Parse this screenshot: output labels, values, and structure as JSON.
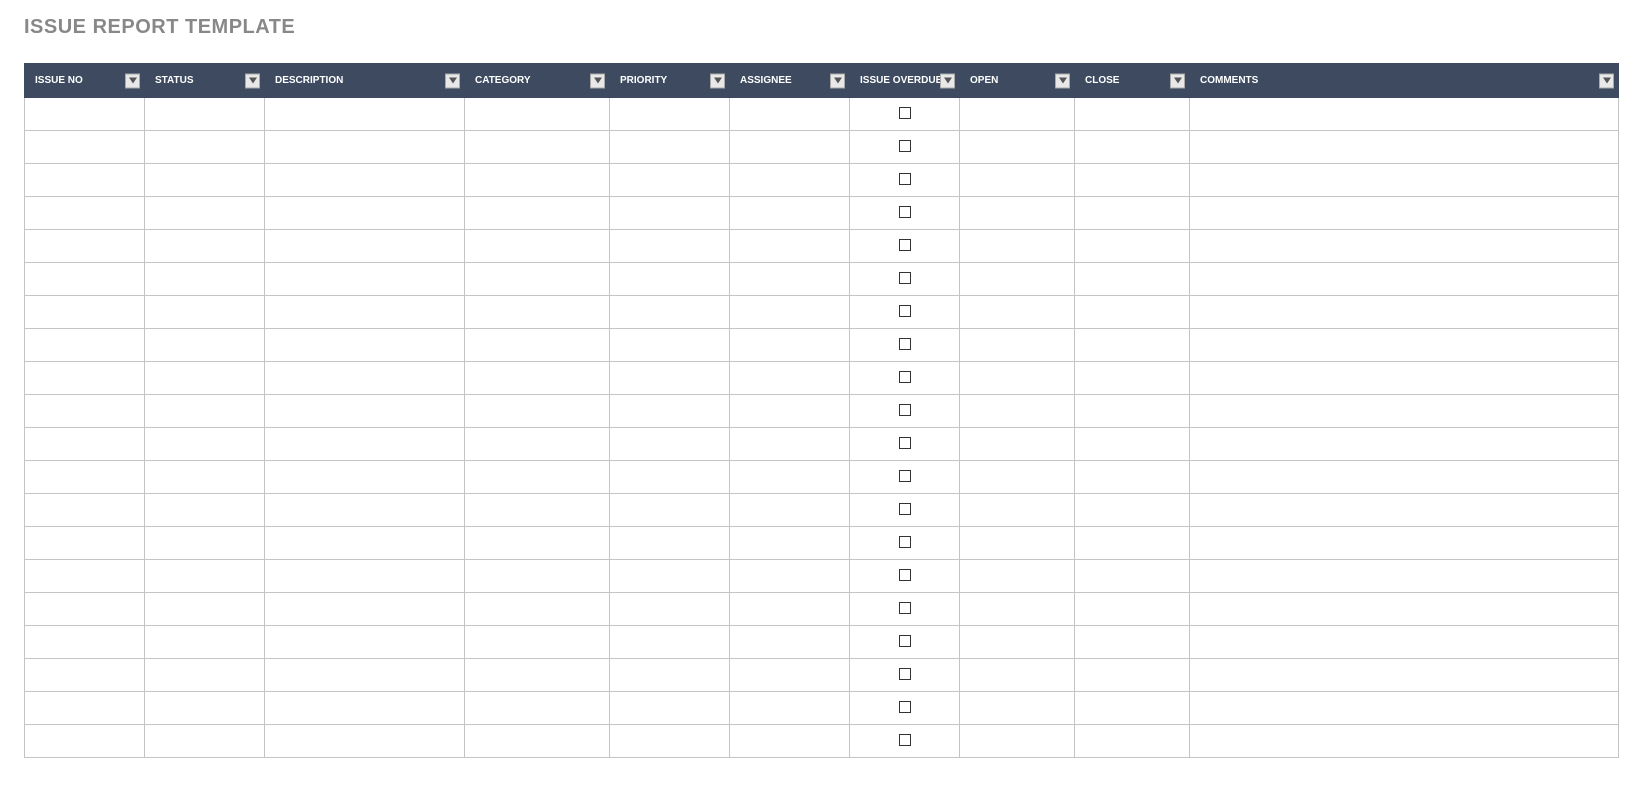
{
  "title": "ISSUE REPORT TEMPLATE",
  "columns": [
    {
      "key": "issue_no",
      "label": "ISSUE NO",
      "class": "col-issue-no",
      "filter": true
    },
    {
      "key": "status",
      "label": "STATUS",
      "class": "col-status",
      "filter": true
    },
    {
      "key": "description",
      "label": "DESCRIPTION",
      "class": "col-description",
      "filter": true
    },
    {
      "key": "category",
      "label": "CATEGORY",
      "class": "col-category",
      "filter": true
    },
    {
      "key": "priority",
      "label": "PRIORITY",
      "class": "col-priority",
      "filter": true
    },
    {
      "key": "assignee",
      "label": "ASSIGNEE",
      "class": "col-assignee",
      "filter": true
    },
    {
      "key": "overdue",
      "label": "ISSUE OVERDUE?",
      "class": "col-overdue",
      "filter": true,
      "type": "checkbox"
    },
    {
      "key": "open",
      "label": "OPEN",
      "class": "col-open",
      "filter": true
    },
    {
      "key": "close",
      "label": "CLOSE",
      "class": "col-close",
      "filter": true
    },
    {
      "key": "comments",
      "label": "COMMENTS",
      "class": "col-comments",
      "filter": true
    }
  ],
  "rows": [
    {
      "issue_no": "",
      "status": "",
      "description": "",
      "category": "",
      "priority": "",
      "assignee": "",
      "overdue": false,
      "open": "",
      "close": "",
      "comments": ""
    },
    {
      "issue_no": "",
      "status": "",
      "description": "",
      "category": "",
      "priority": "",
      "assignee": "",
      "overdue": false,
      "open": "",
      "close": "",
      "comments": ""
    },
    {
      "issue_no": "",
      "status": "",
      "description": "",
      "category": "",
      "priority": "",
      "assignee": "",
      "overdue": false,
      "open": "",
      "close": "",
      "comments": ""
    },
    {
      "issue_no": "",
      "status": "",
      "description": "",
      "category": "",
      "priority": "",
      "assignee": "",
      "overdue": false,
      "open": "",
      "close": "",
      "comments": ""
    },
    {
      "issue_no": "",
      "status": "",
      "description": "",
      "category": "",
      "priority": "",
      "assignee": "",
      "overdue": false,
      "open": "",
      "close": "",
      "comments": ""
    },
    {
      "issue_no": "",
      "status": "",
      "description": "",
      "category": "",
      "priority": "",
      "assignee": "",
      "overdue": false,
      "open": "",
      "close": "",
      "comments": ""
    },
    {
      "issue_no": "",
      "status": "",
      "description": "",
      "category": "",
      "priority": "",
      "assignee": "",
      "overdue": false,
      "open": "",
      "close": "",
      "comments": ""
    },
    {
      "issue_no": "",
      "status": "",
      "description": "",
      "category": "",
      "priority": "",
      "assignee": "",
      "overdue": false,
      "open": "",
      "close": "",
      "comments": ""
    },
    {
      "issue_no": "",
      "status": "",
      "description": "",
      "category": "",
      "priority": "",
      "assignee": "",
      "overdue": false,
      "open": "",
      "close": "",
      "comments": ""
    },
    {
      "issue_no": "",
      "status": "",
      "description": "",
      "category": "",
      "priority": "",
      "assignee": "",
      "overdue": false,
      "open": "",
      "close": "",
      "comments": ""
    },
    {
      "issue_no": "",
      "status": "",
      "description": "",
      "category": "",
      "priority": "",
      "assignee": "",
      "overdue": false,
      "open": "",
      "close": "",
      "comments": ""
    },
    {
      "issue_no": "",
      "status": "",
      "description": "",
      "category": "",
      "priority": "",
      "assignee": "",
      "overdue": false,
      "open": "",
      "close": "",
      "comments": ""
    },
    {
      "issue_no": "",
      "status": "",
      "description": "",
      "category": "",
      "priority": "",
      "assignee": "",
      "overdue": false,
      "open": "",
      "close": "",
      "comments": ""
    },
    {
      "issue_no": "",
      "status": "",
      "description": "",
      "category": "",
      "priority": "",
      "assignee": "",
      "overdue": false,
      "open": "",
      "close": "",
      "comments": ""
    },
    {
      "issue_no": "",
      "status": "",
      "description": "",
      "category": "",
      "priority": "",
      "assignee": "",
      "overdue": false,
      "open": "",
      "close": "",
      "comments": ""
    },
    {
      "issue_no": "",
      "status": "",
      "description": "",
      "category": "",
      "priority": "",
      "assignee": "",
      "overdue": false,
      "open": "",
      "close": "",
      "comments": ""
    },
    {
      "issue_no": "",
      "status": "",
      "description": "",
      "category": "",
      "priority": "",
      "assignee": "",
      "overdue": false,
      "open": "",
      "close": "",
      "comments": ""
    },
    {
      "issue_no": "",
      "status": "",
      "description": "",
      "category": "",
      "priority": "",
      "assignee": "",
      "overdue": false,
      "open": "",
      "close": "",
      "comments": ""
    },
    {
      "issue_no": "",
      "status": "",
      "description": "",
      "category": "",
      "priority": "",
      "assignee": "",
      "overdue": false,
      "open": "",
      "close": "",
      "comments": ""
    },
    {
      "issue_no": "",
      "status": "",
      "description": "",
      "category": "",
      "priority": "",
      "assignee": "",
      "overdue": false,
      "open": "",
      "close": "",
      "comments": ""
    }
  ]
}
